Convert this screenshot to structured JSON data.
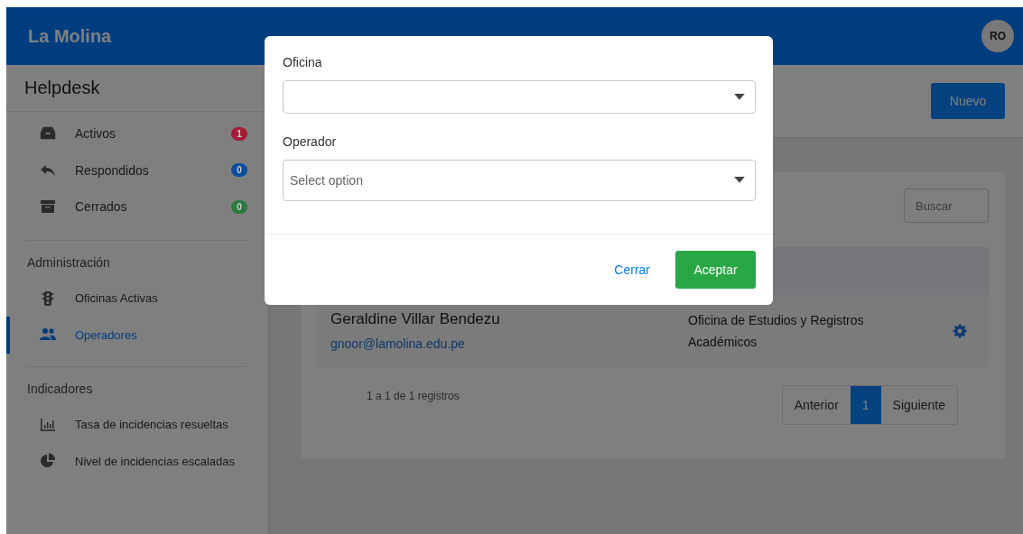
{
  "topbar": {
    "brand": "La Molina",
    "avatar": "RO"
  },
  "sidebar": {
    "title": "Helpdesk",
    "inbox": [
      {
        "label": "Activos",
        "count": "1",
        "color": "#a31c35"
      },
      {
        "label": "Respondidos",
        "count": "0",
        "color": "#0b4e9e"
      },
      {
        "label": "Cerrados",
        "count": "0",
        "color": "#2b7a3e"
      }
    ],
    "sections": [
      {
        "heading": "Administración",
        "items": [
          {
            "label": "Oficinas Activas",
            "selected": false
          },
          {
            "label": "Operadores",
            "selected": true
          }
        ]
      },
      {
        "heading": "Indicadores",
        "items": [
          {
            "label": "Tasa de incidencias resueltas",
            "selected": false
          },
          {
            "label": "Nivel de incidencias escaladas",
            "selected": false
          }
        ]
      }
    ]
  },
  "main": {
    "new_button": "Nuevo",
    "search": {
      "placeholder": "Buscar"
    },
    "rows": [
      {
        "name": "Geraldine Villar Bendezu",
        "email": "gnoor@lamolina.edu.pe",
        "office": "Oficina de Estudios y Registros Académicos"
      }
    ],
    "footer": "1 a 1 de 1 registros",
    "pagination": {
      "previous": "Anterior",
      "pages": [
        {
          "label": "1",
          "selected": true
        }
      ],
      "next": "Siguiente"
    }
  },
  "modal": {
    "fields": [
      {
        "label": "Oficina"
      },
      {
        "label": "Operador",
        "placeholder": "Select option"
      }
    ],
    "close_button": "Cerrar",
    "accept_button": "Aceptar"
  }
}
